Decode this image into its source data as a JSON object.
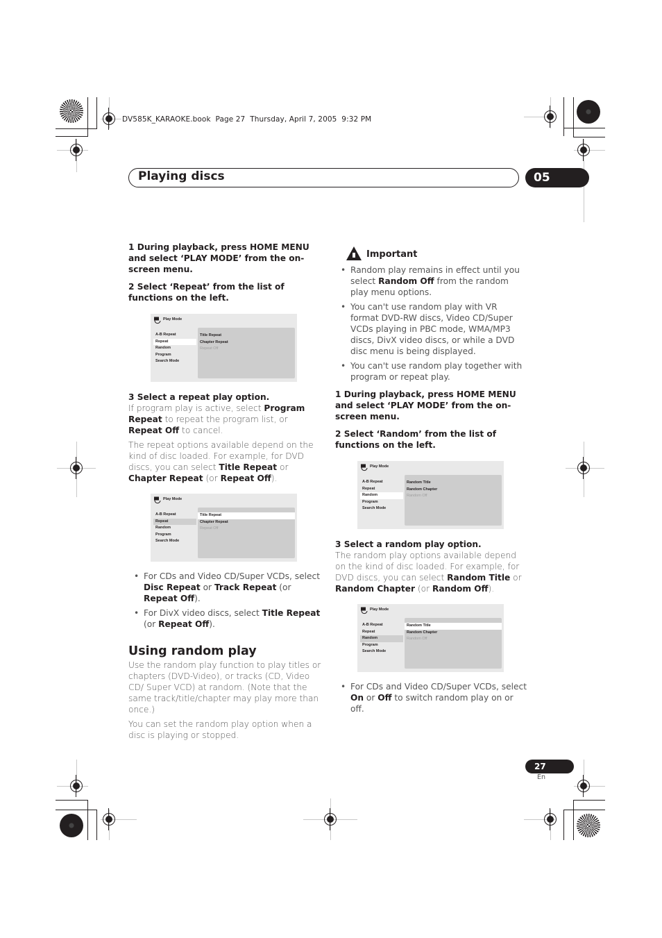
{
  "print_header": "DV585K_KARAOKE.book  Page 27  Thursday, April 7, 2005  9:32 PM",
  "chapter": {
    "title": "Playing discs",
    "number": "05"
  },
  "left_column": {
    "step1": "1    During playback, press HOME MENU and select ‘PLAY MODE’ from the on-screen menu.",
    "step2": "2    Select ‘Repeat’ from the list of functions on the left.",
    "step3_heading": "3    Select a repeat play option.",
    "step3_para1": {
      "t1": "If program play is active, select ",
      "b1": "Program Repeat",
      "t2": " to repeat the program list, or ",
      "b2": "Repeat Off",
      "t3": " to cancel."
    },
    "step3_para2": {
      "t1": "The repeat options available depend on the kind of disc loaded. For example, for DVD discs, you can select ",
      "b1": "Title Repeat",
      "t2": " or ",
      "b2": "Chapter Repeat",
      "t3": " (or ",
      "b3": "Repeat Off",
      "t4": ")."
    },
    "bullets": [
      {
        "t1": "For CDs and Video CD/Super VCDs, select ",
        "b1": "Disc Repeat",
        "t2": " or ",
        "b2": "Track Repeat",
        "t3": " (or ",
        "b3": "Repeat Off",
        "t4": ")."
      },
      {
        "t1": "For DivX video discs, select ",
        "b1": "Title Repeat",
        "t2": " (or ",
        "b2": "Repeat Off",
        "t3": ")."
      }
    ],
    "section_heading": "Using random play",
    "section_para1": "Use the random play function to play titles or chapters (DVD-Video), or tracks (CD, Video CD/ Super VCD) at random. (Note that the same track/title/chapter may play more than once.)",
    "section_para2": "You can set the random play option when a disc is playing or stopped."
  },
  "right_column": {
    "important_label": "Important",
    "important_bullets": [
      {
        "t1": "Random play remains in effect until you select ",
        "b1": "Random Off",
        "t2": " from the random play menu options."
      },
      {
        "t1": "You can't use random play with VR format DVD-RW discs, Video CD/Super VCDs playing in PBC mode, WMA/MP3 discs, DivX video discs, or while a DVD disc menu is being displayed."
      },
      {
        "t1": "You can't use random play together with program or repeat play."
      }
    ],
    "step1": "1    During playback, press HOME MENU and select ‘PLAY MODE’ from the on-screen menu.",
    "step2": "2    Select ‘Random’ from the list of functions on the left.",
    "step3_heading": "3    Select a random play option.",
    "step3_para": {
      "t1": "The random play options available depend on the kind of disc loaded. For example, for DVD discs, you can select ",
      "b1": "Random Title",
      "t2": " or ",
      "b2": "Random Chapter",
      "t3": " (or ",
      "b3": "Random Off",
      "t4": ")."
    },
    "bullet": {
      "t1": "For CDs and Video CD/Super VCDs, select ",
      "b1": "On",
      "t2": " or ",
      "b2": "Off",
      "t3": " to switch random play on or off."
    }
  },
  "screens": {
    "title": "Play Mode",
    "menu": [
      "A-B Repeat",
      "Repeat",
      "Random",
      "Program",
      "Search Mode"
    ],
    "repeat_options": [
      "Title Repeat",
      "Chapter Repeat",
      "Repeat Off"
    ],
    "random_options": [
      "Random Title",
      "Random Chapter",
      "Random Off"
    ]
  },
  "footer": {
    "page_number": "27",
    "language": "En"
  }
}
